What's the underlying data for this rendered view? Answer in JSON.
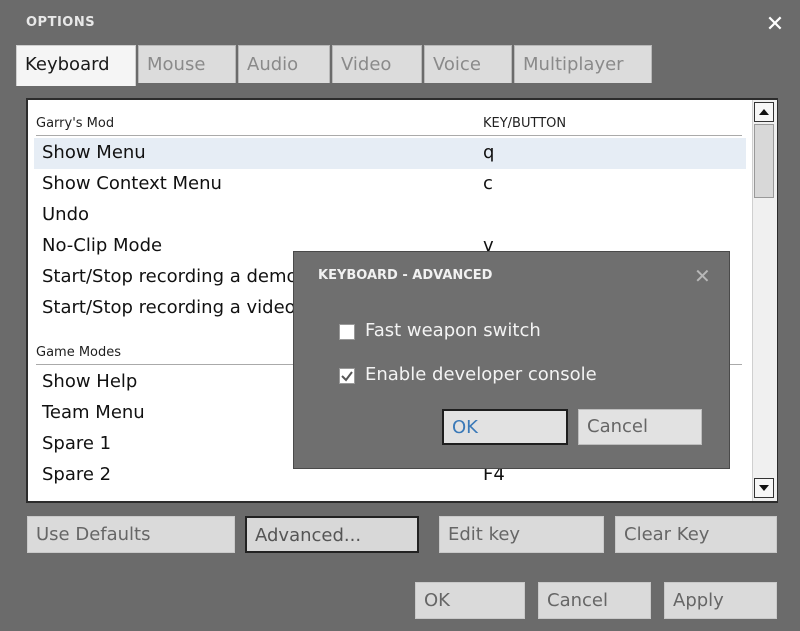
{
  "window": {
    "title": "OPTIONS"
  },
  "tabs": [
    {
      "label": "Keyboard",
      "active": true
    },
    {
      "label": "Mouse"
    },
    {
      "label": "Audio"
    },
    {
      "label": "Video"
    },
    {
      "label": "Voice"
    },
    {
      "label": "Multiplayer"
    }
  ],
  "bindings": {
    "key_column_header": "KEY/BUTTON",
    "sections": [
      {
        "title": "Garry's Mod",
        "rows": [
          {
            "action": "Show Menu",
            "key": "q",
            "selected": true
          },
          {
            "action": "Show Context Menu",
            "key": "c"
          },
          {
            "action": "Undo",
            "key": ""
          },
          {
            "action": "No-Clip Mode",
            "key": "v"
          },
          {
            "action": "Start/Stop recording a demo",
            "key": ""
          },
          {
            "action": "Start/Stop recording a video",
            "key": ""
          }
        ]
      },
      {
        "title": "Game Modes",
        "rows": [
          {
            "action": "Show Help",
            "key": ""
          },
          {
            "action": "Team Menu",
            "key": ""
          },
          {
            "action": "Spare 1",
            "key": ""
          },
          {
            "action": "Spare 2",
            "key": "F4"
          }
        ]
      }
    ]
  },
  "panel_buttons": {
    "use_defaults": "Use Defaults",
    "advanced": "Advanced...",
    "edit_key": "Edit key",
    "clear_key": "Clear Key"
  },
  "footer_buttons": {
    "ok": "OK",
    "cancel": "Cancel",
    "apply": "Apply"
  },
  "dialog": {
    "title": "KEYBOARD - ADVANCED",
    "options": [
      {
        "label": "Fast weapon switch",
        "checked": false
      },
      {
        "label": "Enable developer console",
        "checked": true
      }
    ],
    "ok": "OK",
    "cancel": "Cancel"
  }
}
